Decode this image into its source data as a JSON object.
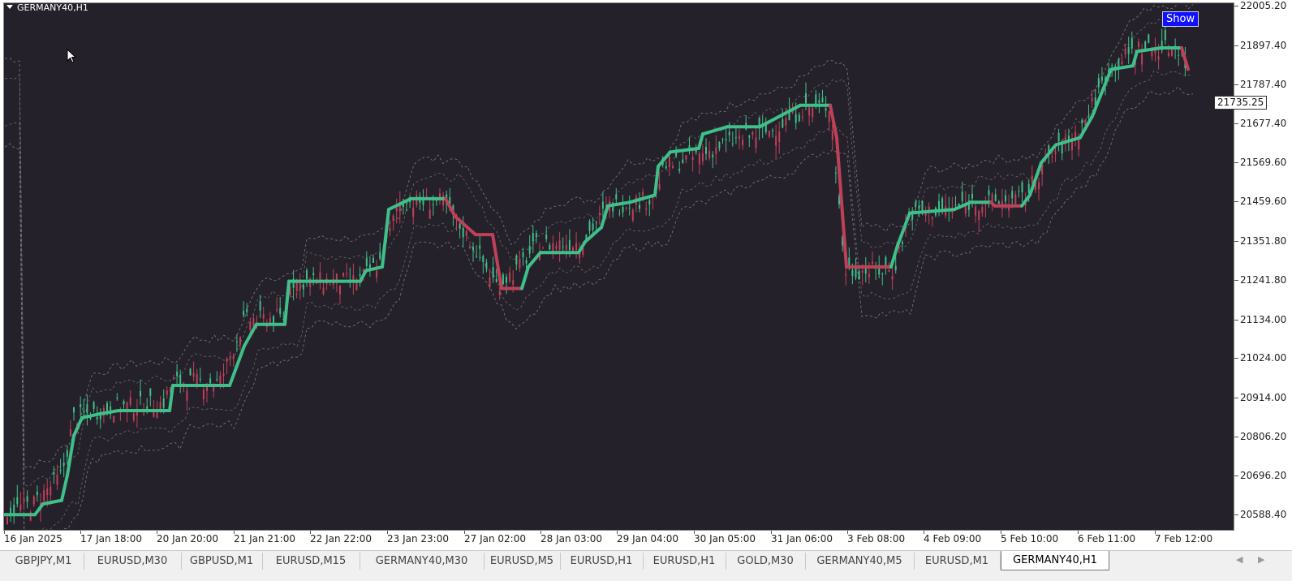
{
  "window": {
    "symbol_title": "GERMANY40,H1",
    "show_button": "Show"
  },
  "price_axis": {
    "ticks": [
      "22005.20",
      "21897.40",
      "21787.40",
      "21677.40",
      "21569.60",
      "21459.60",
      "21351.80",
      "21241.80",
      "21134.00",
      "21024.00",
      "20914.00",
      "20806.20",
      "20696.20",
      "20588.40"
    ],
    "current_price": "21735.25"
  },
  "time_axis": {
    "labels": [
      "16 Jan 2025",
      "17 Jan 18:00",
      "20 Jan 20:00",
      "21 Jan 21:00",
      "22 Jan 22:00",
      "23 Jan 23:00",
      "27 Jan 02:00",
      "28 Jan 03:00",
      "29 Jan 04:00",
      "30 Jan 05:00",
      "31 Jan 06:00",
      "3 Feb 08:00",
      "4 Feb 09:00",
      "5 Feb 10:00",
      "6 Feb 11:00",
      "7 Feb 12:00"
    ]
  },
  "tabs": [
    {
      "label": "GBPJPY,M1"
    },
    {
      "label": "EURUSD,M30"
    },
    {
      "label": "GBPUSD,M1"
    },
    {
      "label": "EURUSD,M15"
    },
    {
      "label": "GERMANY40,M30"
    },
    {
      "label": "EURUSD,M5"
    },
    {
      "label": "EURUSD,H1"
    },
    {
      "label": "EURUSD,H1"
    },
    {
      "label": "GOLD,M30"
    },
    {
      "label": "GERMANY40,M5"
    },
    {
      "label": "EURUSD,M1"
    },
    {
      "label": "GERMANY40,H1",
      "active": true
    }
  ],
  "colors": {
    "background": "#25212a",
    "bull_line": "#3fbf8a",
    "bear_line": "#c0405a",
    "candle_up": "#3fbf8a",
    "candle_down": "#c0405a",
    "bands": "#8a8a8a"
  },
  "icons": {
    "cursor": "mouse-pointer-icon",
    "scroll_left": "arrow-left-icon",
    "scroll_right": "arrow-right-icon",
    "title_toggle": "triangle-down-icon"
  }
}
